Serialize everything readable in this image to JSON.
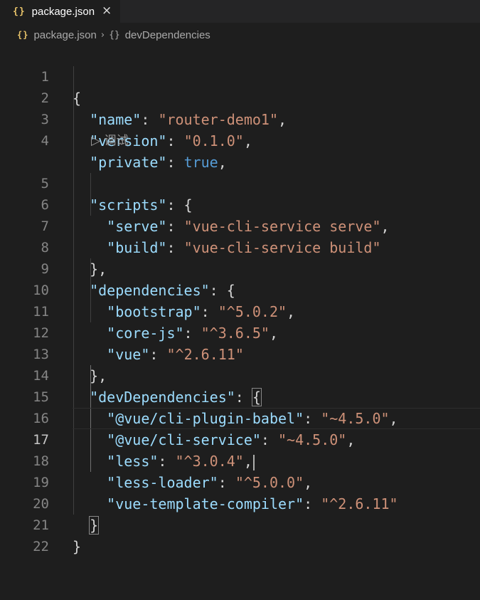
{
  "tab": {
    "icon": "{}",
    "label": "package.json",
    "close_icon": "×"
  },
  "breadcrumb": {
    "file_icon": "{}",
    "file": "package.json",
    "separator": "›",
    "object_icon": "{}",
    "section": "devDependencies"
  },
  "codelens_label": "▷ 调试",
  "line_numbers": [
    "1",
    "2",
    "3",
    "4",
    "5",
    "6",
    "7",
    "8",
    "9",
    "10",
    "11",
    "12",
    "13",
    "14",
    "15",
    "16",
    "17",
    "18",
    "19",
    "20",
    "21",
    "22"
  ],
  "current_line": "17",
  "code": {
    "l1": "{",
    "l2_key": "\"name\"",
    "l2_val": "\"router-demo1\"",
    "l3_key": "\"version\"",
    "l3_val": "\"0.1.0\"",
    "l4_key": "\"private\"",
    "l4_val": "true",
    "l5_key": "\"scripts\"",
    "l6_key": "\"serve\"",
    "l6_val": "\"vue-cli-service serve\"",
    "l7_key": "\"build\"",
    "l7_val": "\"vue-cli-service build\"",
    "l8": "},",
    "l9_key": "\"dependencies\"",
    "l10_key": "\"bootstrap\"",
    "l10_val": "\"^5.0.2\"",
    "l11_key": "\"core-js\"",
    "l11_val": "\"^3.6.5\"",
    "l12_key": "\"vue\"",
    "l12_val": "\"^2.6.11\"",
    "l13": "},",
    "l14_key": "\"devDependencies\"",
    "l15_key": "\"@vue/cli-plugin-babel\"",
    "l15_val": "\"~4.5.0\"",
    "l16_key": "\"@vue/cli-service\"",
    "l16_val": "\"~4.5.0\"",
    "l17_key": "\"less\"",
    "l17_val": "\"^3.0.4\"",
    "l18_key": "\"less-loader\"",
    "l18_val": "\"^5.0.0\"",
    "l19_key": "\"vue-template-compiler\"",
    "l19_val": "\"^2.6.11\"",
    "l20": "}",
    "l21": "}"
  },
  "colors": {
    "background": "#1e1e1e",
    "key": "#9cdcfe",
    "string": "#ce9178",
    "boolean": "#569cd6",
    "json_icon": "#e9c46a"
  }
}
